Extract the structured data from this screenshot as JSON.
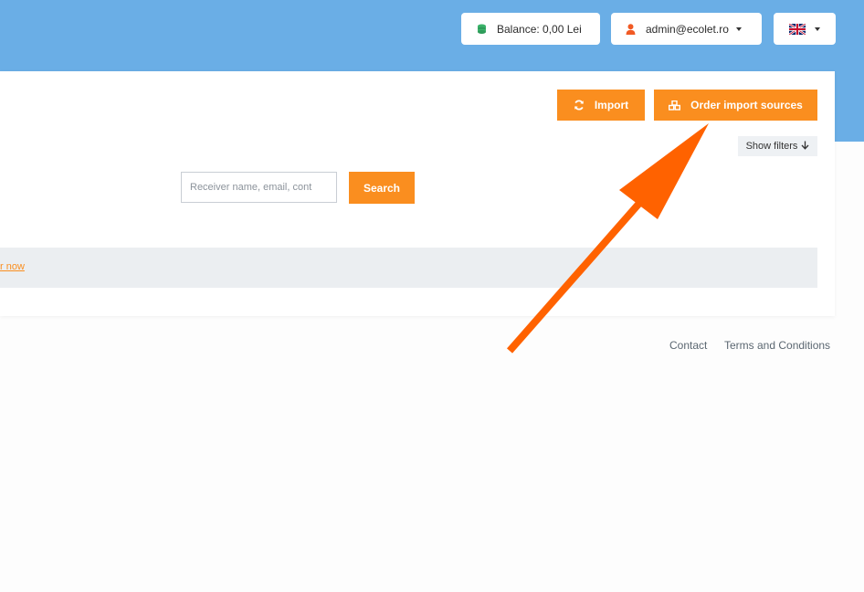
{
  "header": {
    "balance_label": "Balance: 0,00 Lei",
    "user_label": "admin@ecolet.ro",
    "language_icon": "uk-flag-icon"
  },
  "toolbar": {
    "import_label": "Import",
    "order_sources_label": "Order import sources",
    "show_filters_label": "Show filters",
    "show_filters_arrow": "🡓"
  },
  "search": {
    "placeholder": "Receiver name, email, cont",
    "value": "",
    "button_label": "Search"
  },
  "notice": {
    "link_text": "r now"
  },
  "footer": {
    "contact_label": "Contact",
    "terms_label": "Terms and Conditions"
  },
  "colors": {
    "header_bg": "#6aaee6",
    "accent": "#fa8e1f",
    "annotation_arrow": "#ff6200"
  }
}
